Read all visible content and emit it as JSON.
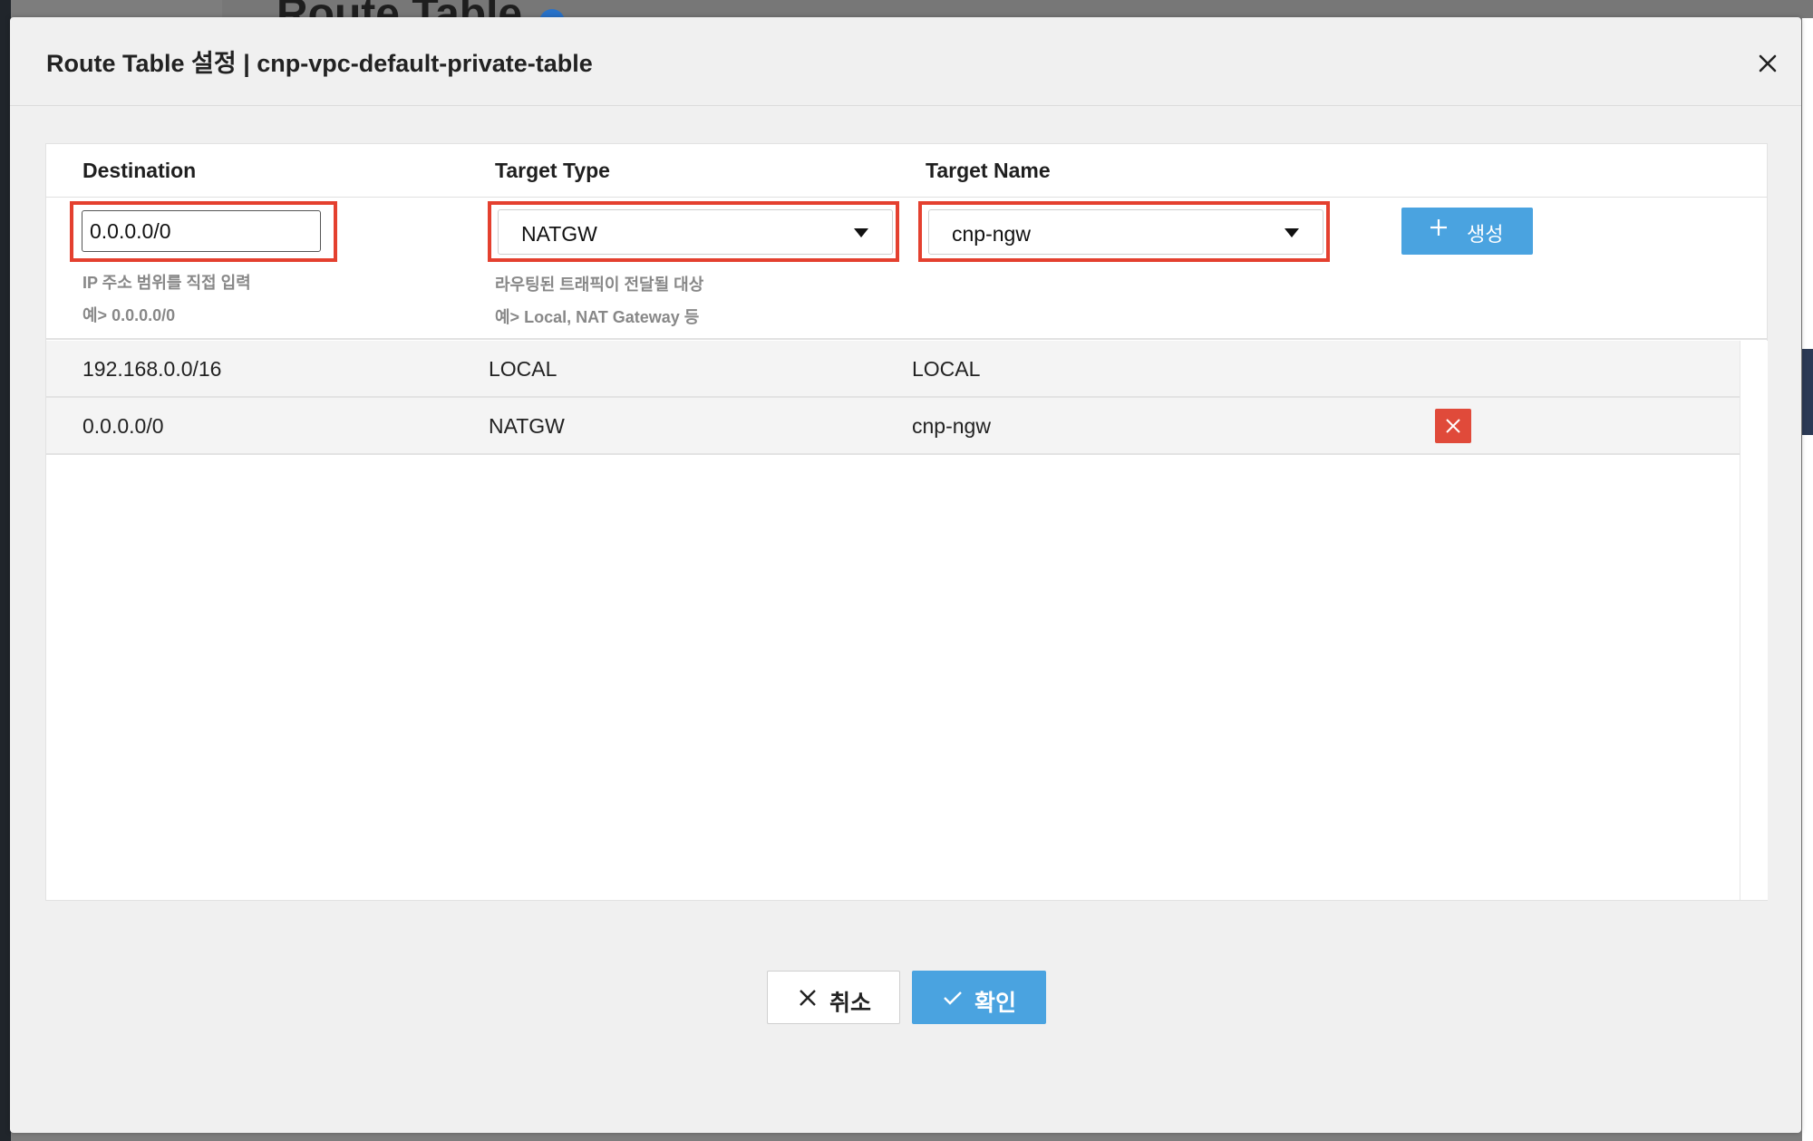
{
  "background": {
    "page_title": "Route Table"
  },
  "modal": {
    "title": "Route Table 설정 | cnp-vpc-default-private-table",
    "columns": [
      "Destination",
      "Target Type",
      "Target Name"
    ],
    "form": {
      "destination_value": "0.0.0.0/0",
      "destination_hint_1": "IP 주소 범위를 직접 입력",
      "destination_hint_2": "예> 0.0.0.0/0",
      "target_type_value": "NATGW",
      "target_type_hint_1": "라우팅된 트래픽이 전달될 대상",
      "target_type_hint_2": "예> Local, NAT Gateway 등",
      "target_name_value": "cnp-ngw",
      "create_label": "생성"
    },
    "routes": [
      {
        "destination": "192.168.0.0/16",
        "target_type": "LOCAL",
        "target_name": "LOCAL",
        "deletable": false
      },
      {
        "destination": "0.0.0.0/0",
        "target_type": "NATGW",
        "target_name": "cnp-ngw",
        "deletable": true
      }
    ],
    "cancel_label": "취소",
    "confirm_label": "확인"
  },
  "colors": {
    "accent": "#4aa3e0",
    "highlight": "#e4402f",
    "danger": "#e04a3a"
  }
}
